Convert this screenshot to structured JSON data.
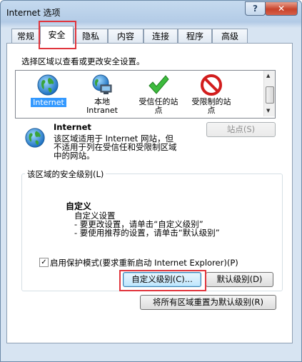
{
  "window": {
    "title": "Internet 选项",
    "help_label": "?",
    "close_label": "✕"
  },
  "tabs": [
    {
      "label": "常规"
    },
    {
      "label": "安全"
    },
    {
      "label": "隐私"
    },
    {
      "label": "内容"
    },
    {
      "label": "连接"
    },
    {
      "label": "程序"
    },
    {
      "label": "高级"
    }
  ],
  "security": {
    "zone_prompt": "选择区域以查看或更改安全设置。",
    "zones": [
      {
        "label1": "Internet",
        "label2": "",
        "icon": "globe-icon"
      },
      {
        "label1": "本地",
        "label2": "Intranet",
        "icon": "intranet-icon"
      },
      {
        "label1": "受信任的站",
        "label2": "点",
        "icon": "checkmark-icon"
      },
      {
        "label1": "受限制的站",
        "label2": "点",
        "icon": "prohibited-icon"
      }
    ],
    "selected_zone": {
      "name": "Internet",
      "desc_lines": [
        "该区域适用于 Internet 网站，但",
        "不适用于列在受信任和受限制区域",
        "中的网站。"
      ]
    },
    "sites_button": "站点(S)",
    "level_group_title": "该区域的安全级别(L)",
    "level": {
      "name": "自定义",
      "lines": [
        "自定义设置",
        "- 要更改设置，请单击“自定义级别”",
        "- 要使用推荐的设置，请单击“默认级别”"
      ]
    },
    "protected_mode_label": "启用保护模式(要求重新启动 Internet Explorer)(P)",
    "protected_mode_checked": true,
    "custom_level_button": "自定义级别(C)...",
    "default_level_button": "默认级别(D)",
    "reset_all_button": "将所有区域重置为默认级别(R)"
  },
  "colors": {
    "highlight": "#e0353d",
    "selection": "#3399ff"
  }
}
